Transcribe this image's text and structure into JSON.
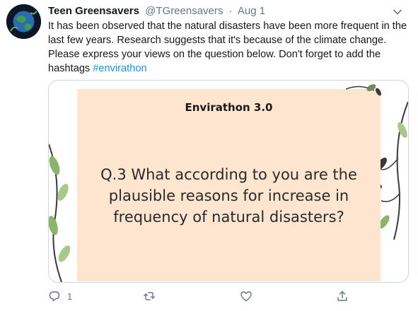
{
  "tweet": {
    "display_name": "Teen Greensavers",
    "handle": "@TGreensavers",
    "separator": "·",
    "date": "Aug 1",
    "text": "It has been observed that the natural disasters have been more frequent in the last few years. Research suggests that it's because of the climate change. Please express your views on the question below. Don't forget to add the hashtags ",
    "hashtag": "#envirathon"
  },
  "card": {
    "title": "Envirathon 3.0",
    "question": "Q.3 What according to you are the plausible reasons for increase in frequency of natural disasters?"
  },
  "actions": {
    "reply_count": "1",
    "retweet_count": "",
    "like_count": ""
  },
  "colors": {
    "accent": "#1b95e0",
    "muted": "#657786",
    "card_bg": "#fde5cf"
  },
  "icons": [
    "caret-down-icon",
    "reply-icon",
    "retweet-icon",
    "like-icon",
    "share-icon"
  ]
}
